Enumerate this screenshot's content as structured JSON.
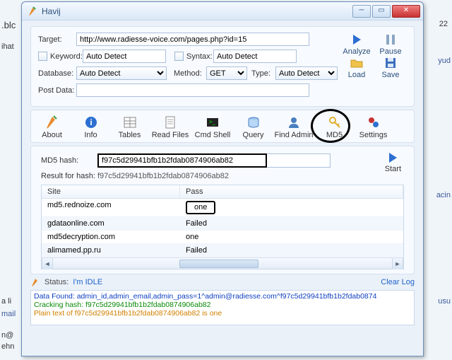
{
  "window": {
    "title": "Havij"
  },
  "form": {
    "target_label": "Target:",
    "target_value": "http://www.radiesse-voice.com/pages.php?id=15",
    "keyword_label": "Keyword:",
    "keyword_value": "Auto Detect",
    "syntax_label": "Syntax:",
    "syntax_value": "Auto Detect",
    "database_label": "Database:",
    "database_value": "Auto Detect",
    "method_label": "Method:",
    "method_value": "GET",
    "type_label": "Type:",
    "type_value": "Auto Detect",
    "postdata_label": "Post Data:",
    "postdata_value": ""
  },
  "actions": {
    "analyze": "Analyze",
    "pause": "Pause",
    "load": "Load",
    "save": "Save"
  },
  "toolbar": {
    "about": "About",
    "info": "Info",
    "tables": "Tables",
    "readfiles": "Read Files",
    "cmdshell": "Cmd Shell",
    "query": "Query",
    "findadmin": "Find Admin",
    "md5": "MD5",
    "settings": "Settings"
  },
  "md5": {
    "hash_label": "MD5 hash:",
    "hash_value": "f97c5d29941bfb1b2fdab0874906ab82",
    "result_label": "Result for hash:",
    "result_value": "f97c5d29941bfb1b2fdab0874906ab82",
    "start": "Start",
    "col_site": "Site",
    "col_pass": "Pass",
    "rows": [
      {
        "site": "md5.rednoize.com",
        "pass": "one"
      },
      {
        "site": "gdataonline.com",
        "pass": "Failed"
      },
      {
        "site": "md5decryption.com",
        "pass": "one"
      },
      {
        "site": "alimamed.pp.ru",
        "pass": "Failed"
      }
    ]
  },
  "status": {
    "label": "Status:",
    "value": "I'm IDLE",
    "clear": "Clear Log"
  },
  "log": {
    "l1": "Data Found: admin_id,admin_email,admin_pass=1^admin@radiesse.com^f97c5d29941bfb1b2fdab0874",
    "l2": "Cracking hash: f97c5d29941bfb1b2fdab0874906ab82",
    "l3": "Plain text of f97c5d29941bfb1b2fdab0874906ab82 is one"
  },
  "bg": {
    "a": "22",
    "b": ".blc",
    "c": "ihat",
    "d": "a li",
    "e": "mail",
    "f": "yud",
    "g": "acin",
    "h": "usu",
    "i": "n@",
    "j": "ehn"
  }
}
